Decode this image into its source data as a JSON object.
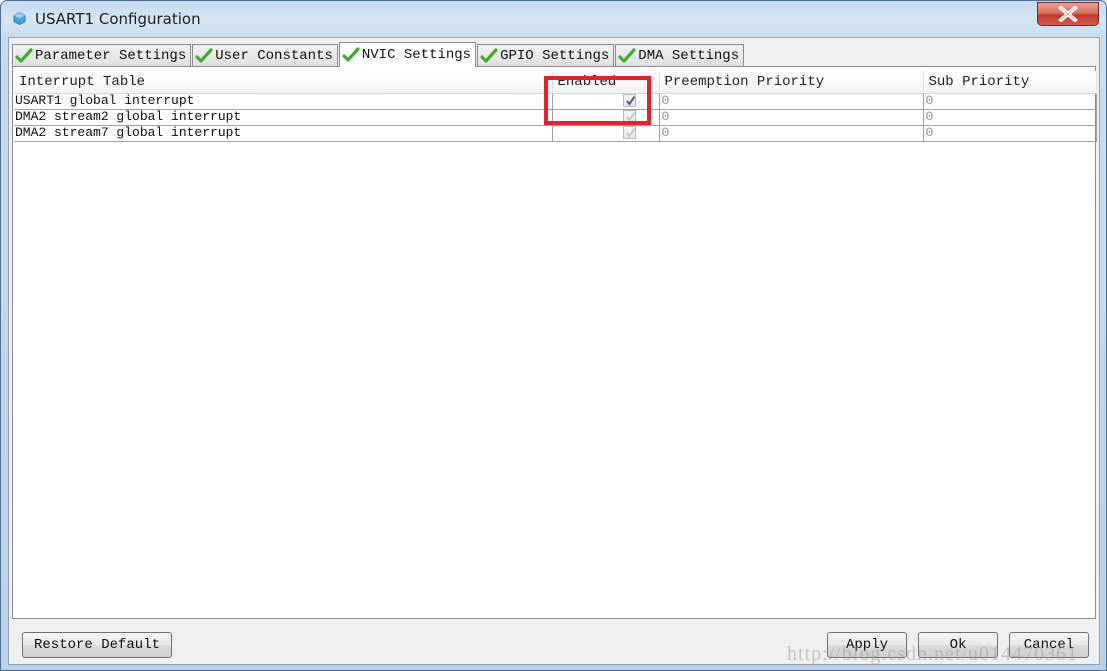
{
  "window": {
    "title": "USART1 Configuration",
    "close_label": "close"
  },
  "tabs": [
    {
      "label": "Parameter Settings",
      "active": false,
      "status_icon": "check-icon"
    },
    {
      "label": "User Constants",
      "active": false,
      "status_icon": "check-icon"
    },
    {
      "label": "NVIC Settings",
      "active": true,
      "status_icon": "check-icon"
    },
    {
      "label": "GPIO Settings",
      "active": false,
      "status_icon": "check-icon"
    },
    {
      "label": "DMA Settings",
      "active": false,
      "status_icon": "check-icon"
    }
  ],
  "table": {
    "headers": [
      "Interrupt Table",
      "Enabled",
      "Preemption Priority",
      "Sub Priority"
    ],
    "rows": [
      {
        "name": "USART1 global interrupt",
        "enabled": true,
        "enabled_editable": true,
        "preemption": "0",
        "sub": "0"
      },
      {
        "name": "DMA2 stream2 global interrupt",
        "enabled": true,
        "enabled_editable": false,
        "preemption": "0",
        "sub": "0"
      },
      {
        "name": "DMA2 stream7 global interrupt",
        "enabled": true,
        "enabled_editable": false,
        "preemption": "0",
        "sub": "0"
      }
    ]
  },
  "buttons": {
    "restore_default": "Restore Default",
    "apply": "Apply",
    "ok": "Ok",
    "cancel": "Cancel"
  },
  "colors": {
    "highlight": "#e8202a",
    "check_active": "#3b5ba0",
    "check_disabled": "#c8c8c8",
    "tab_check": "#3fae2a"
  },
  "watermark": "http://blog.csdn.net/u014470361"
}
